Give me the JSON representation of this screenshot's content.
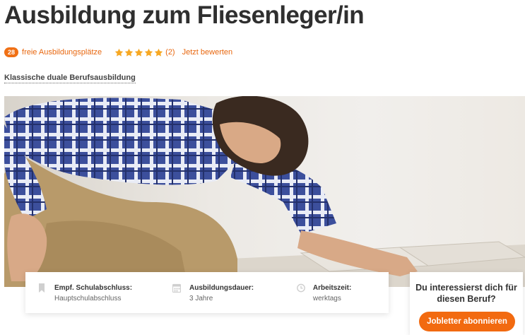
{
  "header": {
    "title": "Ausbildung zum Fliesenleger/in"
  },
  "meta": {
    "count": "28",
    "count_label": "freie Ausbildungsplätze",
    "rating_stars": 5,
    "rating_count": "(2)",
    "rate_link": "Jetzt bewerten",
    "star_color": "#f7a823"
  },
  "subtitle": "Klassische duale Berufsausbildung",
  "hero": {
    "icon": "photo-tiler-laying-floor"
  },
  "info": [
    {
      "icon": "bookmark-icon",
      "label": "Empf. Schulabschluss:",
      "value": "Hauptschulabschluss"
    },
    {
      "icon": "calendar-icon",
      "label": "Ausbildungsdauer:",
      "value": "3 Jahre"
    },
    {
      "icon": "clock-icon",
      "label": "Arbeitszeit:",
      "value": "werktags"
    }
  ],
  "subscribe": {
    "question": "Du interessierst dich für diesen Beruf?",
    "button": "Jobletter abonnieren"
  },
  "colors": {
    "accent": "#f26a10",
    "text": "#2f2f2f"
  }
}
